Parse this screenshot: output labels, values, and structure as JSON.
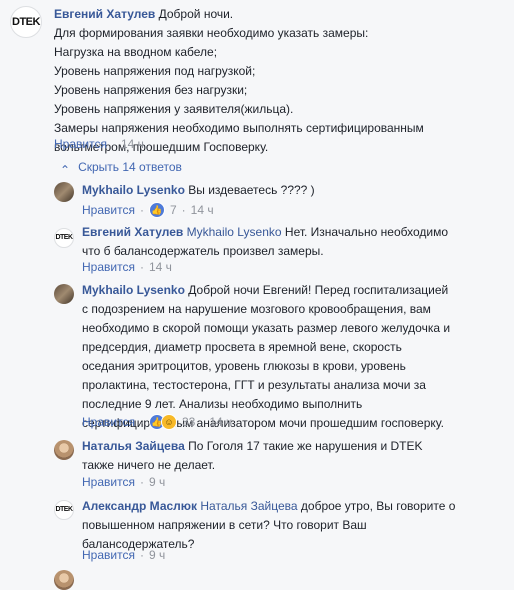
{
  "main_comment": {
    "author": "Евгений Хатулев",
    "lines": [
      "Доброй ночи.",
      "Для формирования заявки необходимо указать замеры:",
      "Нагрузка на вводном кабеле;",
      "Уровень напряжения под нагрузкой;",
      "Уровень напряжения без нагрузки;",
      "Уровень напряжения у заявителя(жильца).",
      "Замеры напряжения необходимо выполнять сертифицированным",
      "вольтметром, прошедшим Госповерку."
    ],
    "like_label": "Нравится",
    "sep": "·",
    "time": "14 ч"
  },
  "replies_toggle": {
    "chevron": "⌃",
    "label": "Скрыть 14 ответов"
  },
  "avatar_logo": "DTEK",
  "replies": [
    {
      "author": "Mykhailo Lysenko",
      "lines": [
        "Вы издеваетесь ???? )"
      ],
      "like_label": "Нравится",
      "sep": "·",
      "reactions": "7",
      "time": "14 ч"
    },
    {
      "author": "Евгений Хатулев",
      "mention": "Mykhailo Lysenko",
      "lines": [
        "Нет. Изначально необходимо",
        "что б балансодержатель произвел замеры."
      ],
      "like_label": "Нравится",
      "sep": "·",
      "time": "14 ч"
    },
    {
      "author": "Mykhailo Lysenko",
      "lines": [
        "Доброй ночи Евгений! Перед госпитализацией",
        "с подозрением на нарушение мозгового кровообращения, вам",
        "необходимо в скорой помощи указать размер левого желудочка и",
        "предсердия, диаметр просвета в яремной вене, скорость",
        "оседания эритроцитов, уровень глюкозы в крови, уровень",
        "пролактина, тестостерона, ГГТ и результаты анализа мочи за",
        "последние 9 лет. Анализы необходимо выполнить",
        "сертифицированым анализатором мочи прошедшим госповерку."
      ],
      "like_label": "Нравится",
      "sep": "·",
      "reactions": "33",
      "time": "14 ч"
    },
    {
      "author": "Наталья Зайцева",
      "lines": [
        "По Гоголя 17 такие же нарушения и DTEK",
        "также ничего не делает."
      ],
      "like_label": "Нравится",
      "sep": "·",
      "time": "9 ч"
    },
    {
      "author": "Александр Маслюк",
      "mention": "Наталья Зайцева",
      "lines": [
        "доброе утро, Вы говорите о",
        "повышенном напряжении в сети? Что говорит Ваш",
        "балансодержатель?"
      ],
      "like_label": "Нравится",
      "sep": "·",
      "time": "9 ч"
    }
  ],
  "colors": {
    "link": "#385898",
    "meta": "#90949c",
    "background": "#f6f7f9"
  },
  "icons": {
    "like": "thumbs-up-icon",
    "haha": "haha-emoji-icon",
    "chevron": "chevron-up-icon"
  }
}
